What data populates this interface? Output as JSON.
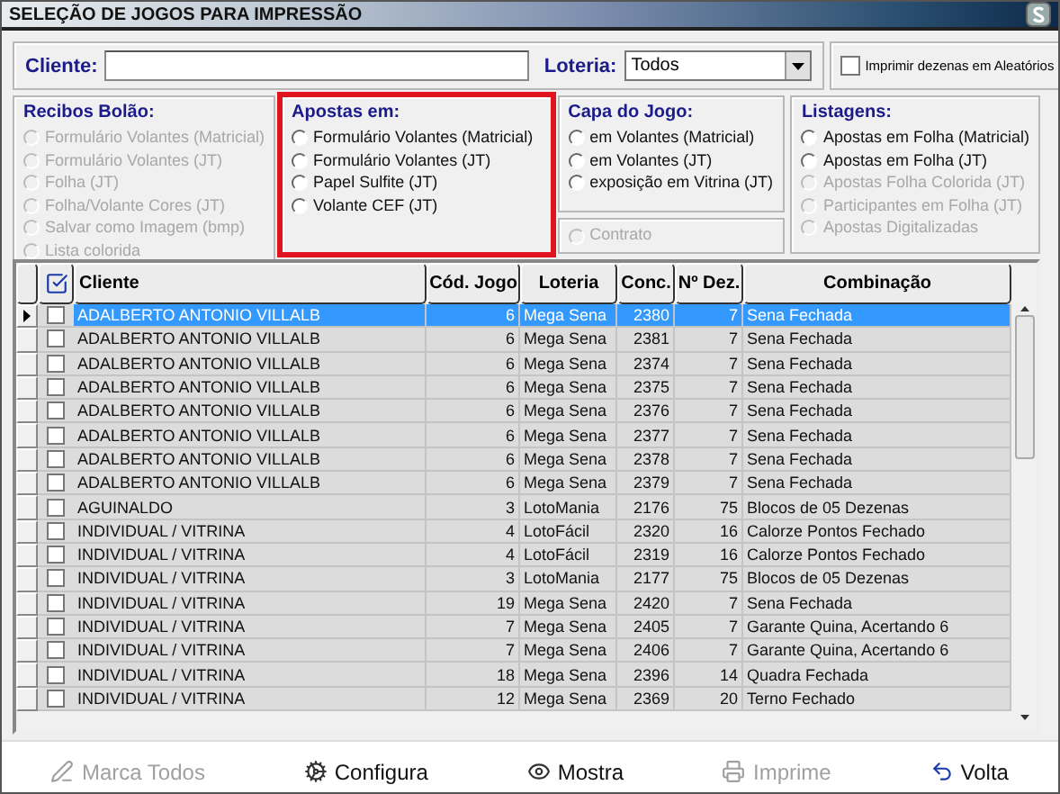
{
  "window": {
    "title": "SELEÇÃO DE JOGOS PARA IMPRESSÃO"
  },
  "filter": {
    "client_label": "Cliente:",
    "lottery_label": "Loteria:",
    "lottery_value": "Todos",
    "print_checkbox": {
      "label": "Imprimir dezenas em Aleatórios",
      "checked": false
    }
  },
  "groups": [
    {
      "title": "Recibos Bolão:",
      "highlighted": false,
      "options": [
        {
          "label": "Formulário Volantes (Matricial)",
          "selected": false,
          "disabled": true
        },
        {
          "label": "Formulário Volantes (JT)",
          "selected": false,
          "disabled": true
        },
        {
          "label": "Folha (JT)",
          "selected": false,
          "disabled": true
        },
        {
          "label": "Folha/Volante Cores (JT)",
          "selected": false,
          "disabled": true
        },
        {
          "label": "Salvar como Imagem (bmp)",
          "selected": false,
          "disabled": true
        },
        {
          "label": "Lista colorida",
          "selected": false,
          "disabled": true
        }
      ]
    },
    {
      "title": "Apostas em:",
      "highlighted": true,
      "options": [
        {
          "label": "Formulário Volantes (Matricial)",
          "selected": false,
          "disabled": false
        },
        {
          "label": "Formulário Volantes (JT)",
          "selected": false,
          "disabled": false
        },
        {
          "label": "Papel Sulfite (JT)",
          "selected": false,
          "disabled": false
        },
        {
          "label": "Volante CEF (JT)",
          "selected": false,
          "disabled": false
        }
      ]
    },
    {
      "title": "Capa do Jogo:",
      "highlighted": false,
      "options": [
        {
          "label": "em Volantes (Matricial)",
          "selected": false,
          "disabled": false
        },
        {
          "label": "em Volantes (JT)",
          "selected": false,
          "disabled": false
        },
        {
          "label": "exposição em Vitrina (JT)",
          "selected": false,
          "disabled": false
        }
      ],
      "extra": {
        "label": "Contrato",
        "selected": false,
        "disabled": true
      }
    },
    {
      "title": "Listagens:",
      "highlighted": false,
      "options": [
        {
          "label": "Apostas em Folha (Matricial)",
          "selected": false,
          "disabled": false
        },
        {
          "label": "Apostas em Folha (JT)",
          "selected": false,
          "disabled": false
        },
        {
          "label": "Apostas Folha Colorida (JT)",
          "selected": false,
          "disabled": true
        },
        {
          "label": "Participantes em Folha (JT)",
          "selected": false,
          "disabled": true
        },
        {
          "label": "Apostas Digitalizadas",
          "selected": false,
          "disabled": true
        }
      ]
    }
  ],
  "table": {
    "columns": [
      "Cliente",
      "Cód. Jogo",
      "Loteria",
      "Conc.",
      "Nº Dez.",
      "Combinação"
    ],
    "rows": [
      {
        "cells": [
          "ADALBERTO ANTONIO VILLALB",
          "6",
          "Mega Sena",
          "2380",
          "7",
          "Sena Fechada"
        ],
        "selected": true,
        "checked": false
      },
      {
        "cells": [
          "ADALBERTO ANTONIO VILLALB",
          "6",
          "Mega Sena",
          "2381",
          "7",
          "Sena Fechada"
        ],
        "selected": false,
        "checked": false
      },
      {
        "cells": [
          "ADALBERTO ANTONIO VILLALB",
          "6",
          "Mega Sena",
          "2374",
          "7",
          "Sena Fechada"
        ],
        "selected": false,
        "checked": false
      },
      {
        "cells": [
          "ADALBERTO ANTONIO VILLALB",
          "6",
          "Mega Sena",
          "2375",
          "7",
          "Sena Fechada"
        ],
        "selected": false,
        "checked": false
      },
      {
        "cells": [
          "ADALBERTO ANTONIO VILLALB",
          "6",
          "Mega Sena",
          "2376",
          "7",
          "Sena Fechada"
        ],
        "selected": false,
        "checked": false
      },
      {
        "cells": [
          "ADALBERTO ANTONIO VILLALB",
          "6",
          "Mega Sena",
          "2377",
          "7",
          "Sena Fechada"
        ],
        "selected": false,
        "checked": false
      },
      {
        "cells": [
          "ADALBERTO ANTONIO VILLALB",
          "6",
          "Mega Sena",
          "2378",
          "7",
          "Sena Fechada"
        ],
        "selected": false,
        "checked": false
      },
      {
        "cells": [
          "ADALBERTO ANTONIO VILLALB",
          "6",
          "Mega Sena",
          "2379",
          "7",
          "Sena Fechada"
        ],
        "selected": false,
        "checked": false
      },
      {
        "cells": [
          "AGUINALDO",
          "3",
          "LotoMania",
          "2176",
          "75",
          "Blocos de 05 Dezenas"
        ],
        "selected": false,
        "checked": false
      },
      {
        "cells": [
          "INDIVIDUAL / VITRINA",
          "4",
          "LotoFácil",
          "2320",
          "16",
          "Calorze Pontos Fechado"
        ],
        "selected": false,
        "checked": false
      },
      {
        "cells": [
          "INDIVIDUAL / VITRINA",
          "4",
          "LotoFácil",
          "2319",
          "16",
          "Calorze Pontos Fechado"
        ],
        "selected": false,
        "checked": false
      },
      {
        "cells": [
          "INDIVIDUAL / VITRINA",
          "3",
          "LotoMania",
          "2177",
          "75",
          "Blocos de 05 Dezenas"
        ],
        "selected": false,
        "checked": false
      },
      {
        "cells": [
          "INDIVIDUAL / VITRINA",
          "19",
          "Mega Sena",
          "2420",
          "7",
          "Sena Fechada"
        ],
        "selected": false,
        "checked": false
      },
      {
        "cells": [
          "INDIVIDUAL / VITRINA",
          "7",
          "Mega Sena",
          "2405",
          "7",
          "Garante Quina, Acertando 6"
        ],
        "selected": false,
        "checked": false
      },
      {
        "cells": [
          "INDIVIDUAL / VITRINA",
          "7",
          "Mega Sena",
          "2406",
          "7",
          "Garante Quina, Acertando 6"
        ],
        "selected": false,
        "checked": false
      },
      {
        "cells": [
          "INDIVIDUAL / VITRINA",
          "18",
          "Mega Sena",
          "2396",
          "14",
          "Quadra Fechada"
        ],
        "selected": false,
        "checked": false
      },
      {
        "cells": [
          "INDIVIDUAL / VITRINA",
          "12",
          "Mega Sena",
          "2369",
          "20",
          "Terno Fechado"
        ],
        "selected": false,
        "checked": false
      }
    ]
  },
  "buttons": [
    {
      "label": "Marca Todos",
      "kind": "mark",
      "disabled": true
    },
    {
      "label": "Configura",
      "kind": "config",
      "disabled": false
    },
    {
      "label": "Mostra",
      "kind": "show",
      "disabled": false
    },
    {
      "label": "Imprime",
      "kind": "print",
      "disabled": true
    },
    {
      "label": "Volta",
      "kind": "back",
      "disabled": false
    }
  ]
}
